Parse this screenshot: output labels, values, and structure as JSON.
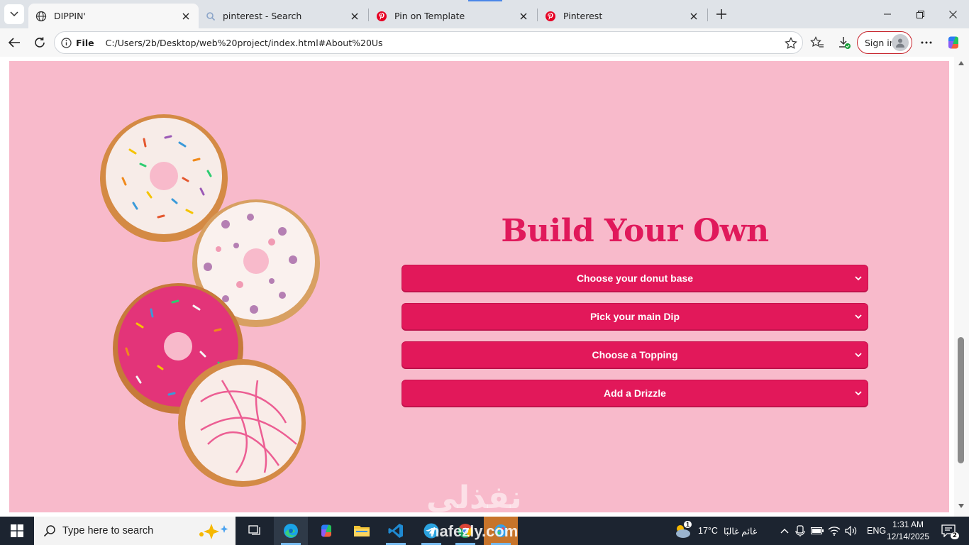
{
  "browser": {
    "tabs": [
      {
        "label": "DIPPIN'",
        "icon": "globe-icon",
        "active": true
      },
      {
        "label": "pinterest - Search",
        "icon": "search-icon",
        "active": false
      },
      {
        "label": "Pin on Template",
        "icon": "pinterest-icon",
        "active": false
      },
      {
        "label": "Pinterest",
        "icon": "pinterest-icon",
        "active": false
      }
    ],
    "address": {
      "scheme": "File",
      "url": "C:/Users/2b/Desktop/web%20project/index.html#About%20Us"
    },
    "sign_in_label": "Sign in"
  },
  "page": {
    "title": "Build Your Own",
    "selects": [
      {
        "label": "Choose your donut base"
      },
      {
        "label": "Pick your main Dip"
      },
      {
        "label": "Choose a Topping"
      },
      {
        "label": "Add a Drizzle"
      }
    ],
    "watermark": "نفذلي"
  },
  "taskbar": {
    "search_placeholder": "Type here to search",
    "watermark": "nafezly.com",
    "weather": {
      "temp": "17°C",
      "condition": "غائم غالبًا",
      "badge": "1"
    },
    "language": "ENG",
    "time": "1:31 AM",
    "date": "12/14/2025",
    "notification_count": "2"
  },
  "colors": {
    "page_background": "#f8bacb",
    "accent": "#e2185a",
    "title": "#e0195b",
    "taskbar": "#1c2430"
  }
}
